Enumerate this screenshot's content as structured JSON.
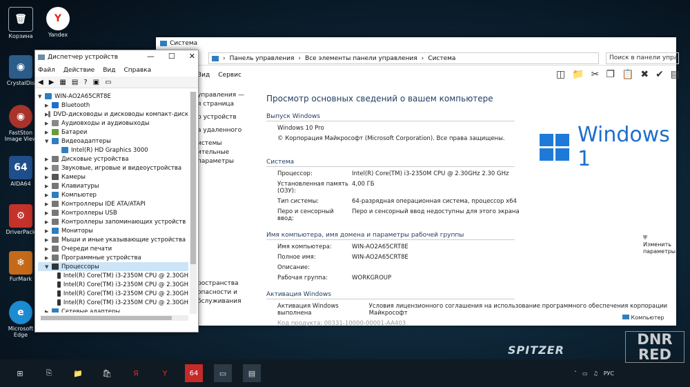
{
  "desktop": {
    "icons": [
      {
        "label": "Корзина"
      },
      {
        "label": "Yandex"
      },
      {
        "label": "CrystalDis"
      },
      {
        "label": "FastSton Image View"
      },
      {
        "label": "AIDA64"
      },
      {
        "label": "DriverPack"
      },
      {
        "label": "FurMark"
      },
      {
        "label": "Microsoft Edge"
      }
    ]
  },
  "system_window": {
    "title": "Система",
    "breadcrumb": [
      "Панель управления",
      "Все элементы панели управления",
      "Система"
    ],
    "search_placeholder": "Поиск в панели управ",
    "menu": [
      "Вид",
      "Сервис"
    ],
    "left_links": [
      "управления —",
      "я страница",
      "р устройств",
      "а удаленного",
      "истемы",
      "ительные параметры",
      "ространства",
      "опасности и",
      "бслуживания"
    ],
    "heading": "Просмотр основных сведений о вашем компьютере",
    "edition": {
      "section": "Выпуск Windows",
      "name": "Windows 10 Pro",
      "copyright": "© Корпорация Майкрософт (Microsoft Corporation). Все права защищены."
    },
    "logo_text": "Windows 1",
    "system": {
      "section": "Система",
      "rows": [
        {
          "k": "Процессор:",
          "v": "Intel(R) Core(TM) i3-2350M CPU @ 2.30GHz   2.30 GHz"
        },
        {
          "k": "Установленная память (ОЗУ):",
          "v": "4,00 ГБ"
        },
        {
          "k": "Тип системы:",
          "v": "64-разрядная операционная система, процессор x64"
        },
        {
          "k": "Перо и сенсорный ввод:",
          "v": "Перо и сенсорный ввод недоступны для этого экрана"
        }
      ]
    },
    "computer": {
      "section": "Имя компьютера, имя домена и параметры рабочей группы",
      "rows": [
        {
          "k": "Имя компьютера:",
          "v": "WIN-AO2A65CRT8E"
        },
        {
          "k": "Полное имя:",
          "v": "WIN-AO2A65CRT8E"
        },
        {
          "k": "Описание:",
          "v": ""
        },
        {
          "k": "Рабочая группа:",
          "v": "WORKGROUP"
        }
      ],
      "change_link": "Изменить параметры"
    },
    "activation": {
      "section": "Активация Windows",
      "status": "Активация Windows выполнена",
      "license_link": "Условия лицензионного соглашения на использование программного обеспечения корпорации Майкрософт",
      "product_key": "Код продукта: 00331-10000-00001-AA403"
    },
    "footer": "Компьютер"
  },
  "device_manager": {
    "title": "Диспетчер устройств",
    "menu": [
      "Файл",
      "Действие",
      "Вид",
      "Справка"
    ],
    "root": "WIN-AO2A65CRT8E",
    "nodes": [
      {
        "label": "Bluetooth",
        "color": "#1e6fcc"
      },
      {
        "label": "DVD-дисководы и дисководы компакт-диск",
        "color": "#777"
      },
      {
        "label": "Аудиовходы и аудиовыходы",
        "color": "#888"
      },
      {
        "label": "Батареи",
        "color": "#6a9a3a"
      },
      {
        "label": "Видеоадаптеры",
        "color": "#2f7fbf",
        "expanded": true
      },
      {
        "label": "Intel(R) HD Graphics 3000",
        "color": "#2f7fbf",
        "child": true
      },
      {
        "label": "Дисковые устройства",
        "color": "#777"
      },
      {
        "label": "Звуковые, игровые и видеоустройства",
        "color": "#888"
      },
      {
        "label": "Камеры",
        "color": "#555"
      },
      {
        "label": "Клавиатуры",
        "color": "#777"
      },
      {
        "label": "Компьютер",
        "color": "#2f7fbf"
      },
      {
        "label": "Контроллеры IDE ATA/ATAPI",
        "color": "#777"
      },
      {
        "label": "Контроллеры USB",
        "color": "#777"
      },
      {
        "label": "Контроллеры запоминающих устройств",
        "color": "#777"
      },
      {
        "label": "Мониторы",
        "color": "#2f7fbf"
      },
      {
        "label": "Мыши и иные указывающие устройства",
        "color": "#777"
      },
      {
        "label": "Очереди печати",
        "color": "#777"
      },
      {
        "label": "Программные устройства",
        "color": "#777"
      },
      {
        "label": "Процессоры",
        "color": "#333",
        "expanded": true,
        "selected": true
      },
      {
        "label": "Intel(R) Core(TM) i3-2350M CPU @ 2.30GH",
        "color": "#333",
        "child": true
      },
      {
        "label": "Intel(R) Core(TM) i3-2350M CPU @ 2.30GH",
        "color": "#333",
        "child": true
      },
      {
        "label": "Intel(R) Core(TM) i3-2350M CPU @ 2.30GH",
        "color": "#333",
        "child": true
      },
      {
        "label": "Intel(R) Core(TM) i3-2350M CPU @ 2.30GH",
        "color": "#333",
        "child": true
      },
      {
        "label": "Сетевые адаптеры",
        "color": "#2f7fbf"
      }
    ]
  },
  "taskbar": {
    "language": "РУС",
    "brand": "SPITZER"
  },
  "watermark": [
    "DNR",
    "RED"
  ]
}
